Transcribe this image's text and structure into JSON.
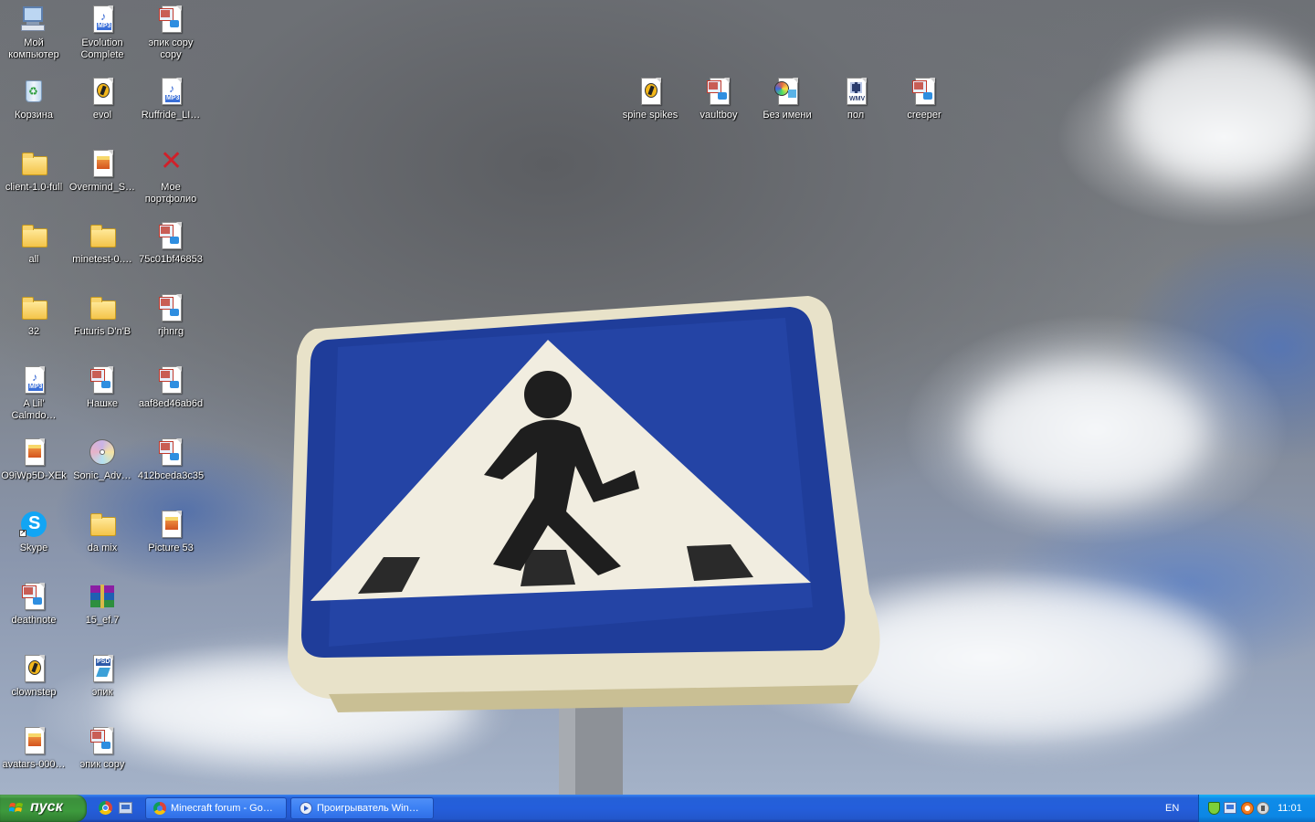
{
  "desktop_icons": [
    {
      "label": "Мой компьютер",
      "icon": "my-computer-icon",
      "type": "computer"
    },
    {
      "label": "Evolution Complete",
      "icon": "mp3-file-icon",
      "type": "mp3"
    },
    {
      "label": "эпик copy copy",
      "icon": "picture-file-icon",
      "type": "pic"
    },
    {
      "label": "Корзина",
      "icon": "recycle-bin-icon",
      "type": "recycle"
    },
    {
      "label": "evol",
      "icon": "fl-studio-icon",
      "type": "flp"
    },
    {
      "label": "Ruffride_LI…",
      "icon": "mp3-file-icon",
      "type": "mp3"
    },
    {
      "label": "client-1.0-full",
      "icon": "folder-icon",
      "type": "folder"
    },
    {
      "label": "Overmind_S…",
      "icon": "image-file-icon",
      "type": "img"
    },
    {
      "label": "Мое портфолио",
      "icon": "broken-shortcut-icon",
      "type": "x"
    },
    {
      "label": "all",
      "icon": "folder-icon",
      "type": "folder"
    },
    {
      "label": "minetest-0.…",
      "icon": "folder-icon",
      "type": "folder"
    },
    {
      "label": "75c01bf46853",
      "icon": "picture-file-icon",
      "type": "pic"
    },
    {
      "label": "32",
      "icon": "folder-icon",
      "type": "folder"
    },
    {
      "label": "Futuris D'n'B",
      "icon": "folder-icon",
      "type": "folder"
    },
    {
      "label": "rjhnrg",
      "icon": "picture-file-icon",
      "type": "pic"
    },
    {
      "label": "A Lil' Calmdo…",
      "icon": "mp3-file-icon",
      "type": "mp3"
    },
    {
      "label": "Нашке",
      "icon": "picture-file-icon",
      "type": "pic"
    },
    {
      "label": "aaf8ed46ab6d",
      "icon": "picture-file-icon",
      "type": "pic"
    },
    {
      "label": "O9iWp5D-XEk",
      "icon": "image-file-icon",
      "type": "img"
    },
    {
      "label": "Sonic_Adv…",
      "icon": "disc-image-icon",
      "type": "disc"
    },
    {
      "label": "412bceda3c35",
      "icon": "picture-file-icon",
      "type": "pic"
    },
    {
      "label": "Skype",
      "icon": "skype-icon",
      "type": "skype"
    },
    {
      "label": "da mix",
      "icon": "folder-icon",
      "type": "folder"
    },
    {
      "label": "Picture 53",
      "icon": "image-file-icon",
      "type": "img"
    },
    {
      "label": "deathnote",
      "icon": "picture-file-icon",
      "type": "pic"
    },
    {
      "label": "15_ef.7",
      "icon": "rar-archive-icon",
      "type": "rar"
    },
    {
      "label": "clownstep",
      "icon": "fl-studio-icon",
      "type": "flp"
    },
    {
      "label": "эпик",
      "icon": "psd-file-icon",
      "type": "psd"
    },
    {
      "label": "avatars-000…",
      "icon": "image-file-icon",
      "type": "img"
    },
    {
      "label": "эпик copy",
      "icon": "picture-file-icon",
      "type": "pic"
    },
    {
      "label": "spine spikes",
      "icon": "fl-studio-icon",
      "type": "flp"
    },
    {
      "label": "vaultboy",
      "icon": "picture-file-icon",
      "type": "pic"
    },
    {
      "label": "Без имени",
      "icon": "video-project-icon",
      "type": "video"
    },
    {
      "label": "пол",
      "icon": "wmv-file-icon",
      "type": "wmv"
    },
    {
      "label": "creeper",
      "icon": "picture-file-icon",
      "type": "pic"
    }
  ],
  "taskbar": {
    "start_label": "пуск",
    "quick_launch": [
      {
        "icon": "chrome-icon"
      },
      {
        "icon": "show-desktop-icon"
      }
    ],
    "tasks": [
      {
        "label": "Minecraft forum - Go…",
        "icon": "chrome-icon",
        "active": false
      },
      {
        "label": "Проигрыватель Win…",
        "icon": "media-player-icon",
        "active": false
      }
    ],
    "language": "EN",
    "tray_icons": [
      "shield-icon",
      "network-icon",
      "avast-icon",
      "volume-icon"
    ],
    "clock": "11:01"
  },
  "colors": {
    "taskbar_blue": "#245edb",
    "start_green": "#3c8f3c",
    "tray_blue": "#0f8ce9",
    "sign_blue": "#1f3d9a"
  }
}
